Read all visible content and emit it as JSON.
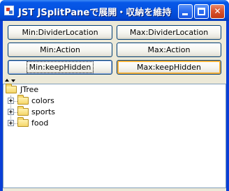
{
  "window": {
    "title": "JST JSplitPaneで展開・収納を維持"
  },
  "buttons": {
    "min_divider_location": "Min:DividerLocation",
    "max_divider_location": "Max:DividerLocation",
    "min_action": "Min:Action",
    "max_action": "Max:Action",
    "min_keep_hidden": "Min:keepHidden",
    "max_keep_hidden": "Max:keepHidden"
  },
  "tree": {
    "root": "JTree",
    "children": [
      "colors",
      "sports",
      "food"
    ]
  },
  "icons": {
    "app": "java-app-icon",
    "folder": "folder-icon",
    "expand": "plus-expander-icon"
  },
  "colors": {
    "titlebar": "#0451e0",
    "client": "#ece9d8",
    "focus_ring": "#f8b33b"
  }
}
